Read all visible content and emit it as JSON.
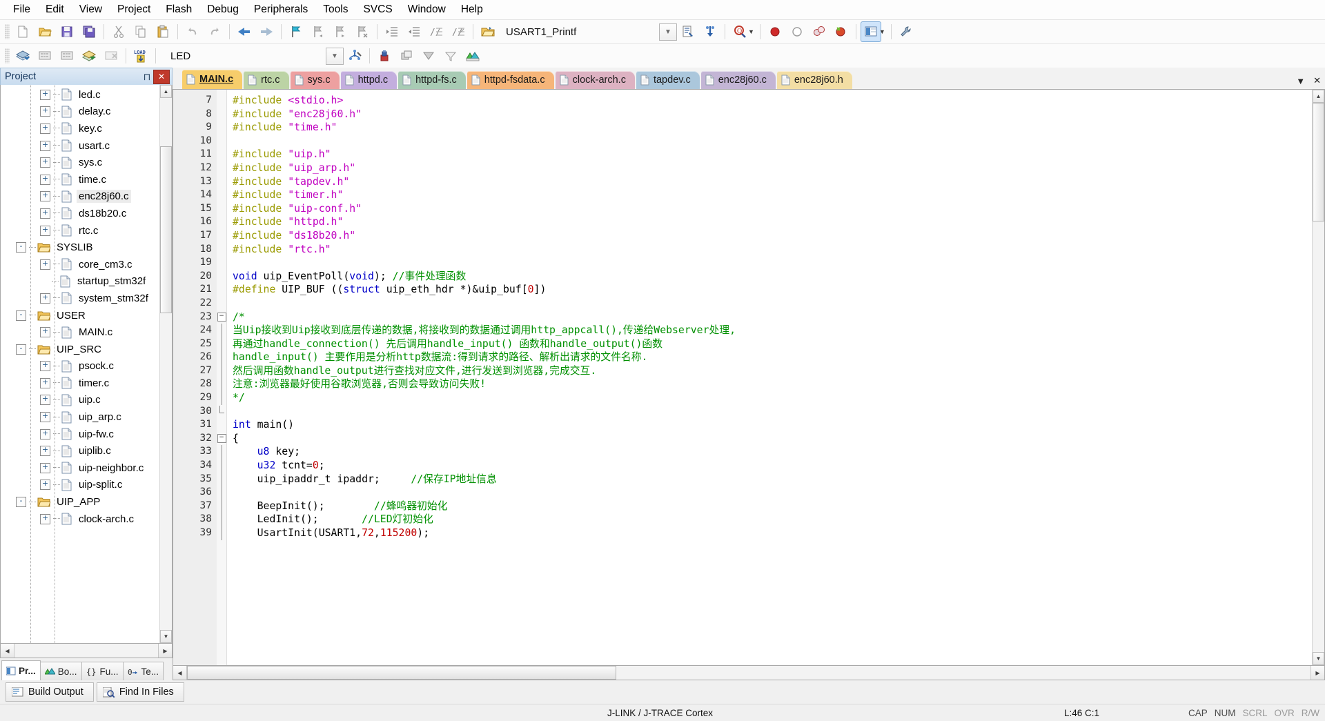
{
  "menu": {
    "items": [
      "File",
      "Edit",
      "View",
      "Project",
      "Flash",
      "Debug",
      "Peripherals",
      "Tools",
      "SVCS",
      "Window",
      "Help"
    ]
  },
  "toolbar1": {
    "icons": [
      {
        "name": "new-file-icon",
        "glyph": "new"
      },
      {
        "name": "open-file-icon",
        "glyph": "open"
      },
      {
        "name": "save-icon",
        "glyph": "save"
      },
      {
        "name": "save-all-icon",
        "glyph": "saveall"
      },
      {
        "name": "cut-icon",
        "glyph": "cut"
      },
      {
        "name": "copy-icon",
        "glyph": "copy"
      },
      {
        "name": "paste-icon",
        "glyph": "paste"
      },
      {
        "name": "undo-icon",
        "glyph": "undo"
      },
      {
        "name": "redo-icon",
        "glyph": "redo"
      },
      {
        "name": "navigate-back-icon",
        "glyph": "back"
      },
      {
        "name": "navigate-forward-icon",
        "glyph": "forward"
      },
      {
        "name": "bookmark-toggle-icon",
        "glyph": "bm-toggle"
      },
      {
        "name": "bookmark-prev-icon",
        "glyph": "bm-prev"
      },
      {
        "name": "bookmark-next-icon",
        "glyph": "bm-next"
      },
      {
        "name": "bookmark-clear-icon",
        "glyph": "bm-clear"
      },
      {
        "name": "indent-icon",
        "glyph": "indent"
      },
      {
        "name": "outdent-icon",
        "glyph": "outdent"
      },
      {
        "name": "comment-icon",
        "glyph": "comment"
      },
      {
        "name": "uncomment-icon",
        "glyph": "uncomment"
      }
    ],
    "project_name": "USART1_Printf",
    "project_icon": "project-folder-icon",
    "after_combo": [
      {
        "name": "target-options-icon",
        "glyph": "target-opt"
      },
      {
        "name": "manage-components-icon",
        "glyph": "manage"
      },
      {
        "name": "find-in-files-icon",
        "glyph": "find-q"
      },
      {
        "name": "insert-breakpoint-icon",
        "glyph": "bp-red"
      },
      {
        "name": "disable-breakpoint-icon",
        "glyph": "bp-hollow"
      },
      {
        "name": "disable-all-breakpoints-icon",
        "glyph": "bp-dis"
      },
      {
        "name": "kill-all-breakpoints-icon",
        "glyph": "bp-kill"
      },
      {
        "name": "configuration-wizard-icon",
        "glyph": "cfgwiz"
      },
      {
        "name": "utilities-icon",
        "glyph": "wrench"
      }
    ]
  },
  "toolbar2": {
    "icons": [
      {
        "name": "translate-icon",
        "glyph": "translate"
      },
      {
        "name": "build-icon",
        "glyph": "build"
      },
      {
        "name": "rebuild-icon",
        "glyph": "rebuild"
      },
      {
        "name": "batch-build-icon",
        "glyph": "batchbuild"
      },
      {
        "name": "stop-build-icon",
        "glyph": "stopbuild"
      },
      {
        "name": "download-icon",
        "glyph": "load"
      }
    ],
    "target_name": "LED",
    "after_combo": [
      {
        "name": "target-options-icon-2",
        "glyph": "tgt-opt2"
      },
      {
        "name": "manage-project-items-icon",
        "glyph": "mpi"
      },
      {
        "name": "multi-project-icon",
        "glyph": "multi"
      },
      {
        "name": "source-browse-icon",
        "glyph": "srcbrowse"
      },
      {
        "name": "filter-icon",
        "glyph": "filter"
      },
      {
        "name": "books-icon",
        "glyph": "books"
      }
    ]
  },
  "project_pane": {
    "title": "Project",
    "pin_icon": "pin-icon",
    "close_icon": "close-icon",
    "tree": [
      {
        "label": "led.c",
        "type": "file",
        "depth": 2,
        "expander": "+"
      },
      {
        "label": "delay.c",
        "type": "file",
        "depth": 2,
        "expander": "+"
      },
      {
        "label": "key.c",
        "type": "file",
        "depth": 2,
        "expander": "+"
      },
      {
        "label": "usart.c",
        "type": "file",
        "depth": 2,
        "expander": "+"
      },
      {
        "label": "sys.c",
        "type": "file",
        "depth": 2,
        "expander": "+"
      },
      {
        "label": "time.c",
        "type": "file",
        "depth": 2,
        "expander": "+"
      },
      {
        "label": "enc28j60.c",
        "type": "file",
        "depth": 2,
        "expander": "+",
        "selected": true
      },
      {
        "label": "ds18b20.c",
        "type": "file",
        "depth": 2,
        "expander": "+"
      },
      {
        "label": "rtc.c",
        "type": "file",
        "depth": 2,
        "expander": "+"
      },
      {
        "label": "SYSLIB",
        "type": "folder",
        "depth": 1,
        "expander": "-"
      },
      {
        "label": "core_cm3.c",
        "type": "file",
        "depth": 2,
        "expander": "+"
      },
      {
        "label": "startup_stm32f",
        "type": "file",
        "depth": 2,
        "expander": ""
      },
      {
        "label": "system_stm32f",
        "type": "file",
        "depth": 2,
        "expander": "+"
      },
      {
        "label": "USER",
        "type": "folder",
        "depth": 1,
        "expander": "-"
      },
      {
        "label": "MAIN.c",
        "type": "file",
        "depth": 2,
        "expander": "+"
      },
      {
        "label": "UIP_SRC",
        "type": "folder",
        "depth": 1,
        "expander": "-"
      },
      {
        "label": "psock.c",
        "type": "file",
        "depth": 2,
        "expander": "+"
      },
      {
        "label": "timer.c",
        "type": "file",
        "depth": 2,
        "expander": "+"
      },
      {
        "label": "uip.c",
        "type": "file",
        "depth": 2,
        "expander": "+"
      },
      {
        "label": "uip_arp.c",
        "type": "file",
        "depth": 2,
        "expander": "+"
      },
      {
        "label": "uip-fw.c",
        "type": "file",
        "depth": 2,
        "expander": "+"
      },
      {
        "label": "uiplib.c",
        "type": "file",
        "depth": 2,
        "expander": "+"
      },
      {
        "label": "uip-neighbor.c",
        "type": "file",
        "depth": 2,
        "expander": "+"
      },
      {
        "label": "uip-split.c",
        "type": "file",
        "depth": 2,
        "expander": "+"
      },
      {
        "label": "UIP_APP",
        "type": "folder",
        "depth": 1,
        "expander": "-"
      },
      {
        "label": "clock-arch.c",
        "type": "file",
        "depth": 2,
        "expander": "+"
      }
    ],
    "tabs": [
      {
        "label": "Pr...",
        "icon": "project-tab-icon",
        "active": true
      },
      {
        "label": "Bo...",
        "icon": "books-tab-icon",
        "active": false
      },
      {
        "label": "Fu...",
        "icon": "functions-tab-icon",
        "active": false
      },
      {
        "label": "Te...",
        "icon": "templates-tab-icon",
        "active": false
      }
    ]
  },
  "editor": {
    "tabs": [
      {
        "label": "MAIN.c",
        "color": "#f7cd6b",
        "active": true
      },
      {
        "label": "rtc.c",
        "color": "#bcd3a5",
        "active": false
      },
      {
        "label": "sys.c",
        "color": "#eda0a0",
        "active": false
      },
      {
        "label": "httpd.c",
        "color": "#c3aede",
        "active": false
      },
      {
        "label": "httpd-fs.c",
        "color": "#a8cbb4",
        "active": false
      },
      {
        "label": "httpd-fsdata.c",
        "color": "#f6b579",
        "active": false
      },
      {
        "label": "clock-arch.c",
        "color": "#ddb2c2",
        "active": false
      },
      {
        "label": "tapdev.c",
        "color": "#abc7dc",
        "active": false
      },
      {
        "label": "enc28j60.c",
        "color": "#c3b5d5",
        "active": false
      },
      {
        "label": "enc28j60.h",
        "color": "#f3dea4",
        "active": false
      }
    ],
    "tab_scroll_icon": "chevron-down-icon",
    "tab_close_icon": "close-icon",
    "first_line": 7,
    "lines": [
      {
        "n": 7,
        "fold": "",
        "tokens": [
          {
            "t": "#include ",
            "c": "pp"
          },
          {
            "t": "<stdio.h>",
            "c": "st"
          }
        ]
      },
      {
        "n": 8,
        "fold": "",
        "tokens": [
          {
            "t": "#include ",
            "c": "pp"
          },
          {
            "t": "\"enc28j60.h\"",
            "c": "st"
          }
        ]
      },
      {
        "n": 9,
        "fold": "",
        "tokens": [
          {
            "t": "#include ",
            "c": "pp"
          },
          {
            "t": "\"time.h\"",
            "c": "st"
          }
        ]
      },
      {
        "n": 10,
        "fold": "",
        "tokens": []
      },
      {
        "n": 11,
        "fold": "",
        "tokens": [
          {
            "t": "#include ",
            "c": "pp"
          },
          {
            "t": "\"uip.h\"",
            "c": "st"
          }
        ]
      },
      {
        "n": 12,
        "fold": "",
        "tokens": [
          {
            "t": "#include ",
            "c": "pp"
          },
          {
            "t": "\"uip_arp.h\"",
            "c": "st"
          }
        ]
      },
      {
        "n": 13,
        "fold": "",
        "tokens": [
          {
            "t": "#include ",
            "c": "pp"
          },
          {
            "t": "\"tapdev.h\"",
            "c": "st"
          }
        ]
      },
      {
        "n": 14,
        "fold": "",
        "tokens": [
          {
            "t": "#include ",
            "c": "pp"
          },
          {
            "t": "\"timer.h\"",
            "c": "st"
          }
        ]
      },
      {
        "n": 15,
        "fold": "",
        "tokens": [
          {
            "t": "#include ",
            "c": "pp"
          },
          {
            "t": "\"uip-conf.h\"",
            "c": "st"
          }
        ]
      },
      {
        "n": 16,
        "fold": "",
        "tokens": [
          {
            "t": "#include ",
            "c": "pp"
          },
          {
            "t": "\"httpd.h\"",
            "c": "st"
          }
        ]
      },
      {
        "n": 17,
        "fold": "",
        "tokens": [
          {
            "t": "#include ",
            "c": "pp"
          },
          {
            "t": "\"ds18b20.h\"",
            "c": "st"
          }
        ]
      },
      {
        "n": 18,
        "fold": "",
        "tokens": [
          {
            "t": "#include ",
            "c": "pp"
          },
          {
            "t": "\"rtc.h\"",
            "c": "st"
          }
        ]
      },
      {
        "n": 19,
        "fold": "",
        "tokens": []
      },
      {
        "n": 20,
        "fold": "",
        "tokens": [
          {
            "t": "void",
            "c": "k"
          },
          {
            "t": " uip_EventPoll(",
            "c": "pl"
          },
          {
            "t": "void",
            "c": "k"
          },
          {
            "t": "); ",
            "c": "pl"
          },
          {
            "t": "//事件处理函数",
            "c": "cm"
          }
        ]
      },
      {
        "n": 21,
        "fold": "",
        "tokens": [
          {
            "t": "#define",
            "c": "pp"
          },
          {
            "t": " UIP_BUF ((",
            "c": "pl"
          },
          {
            "t": "struct",
            "c": "k"
          },
          {
            "t": " uip_eth_hdr *)&uip_buf[",
            "c": "pl"
          },
          {
            "t": "0",
            "c": "num"
          },
          {
            "t": "])",
            "c": "pl"
          }
        ]
      },
      {
        "n": 22,
        "fold": "",
        "tokens": []
      },
      {
        "n": 23,
        "fold": "-",
        "tokens": [
          {
            "t": "/*",
            "c": "cm"
          }
        ]
      },
      {
        "n": 24,
        "fold": "|",
        "tokens": [
          {
            "t": "当Uip接收到Uip接收到底层传递的数据,将接收到的数据通过调用http_appcall(),传递给Webserver处理,",
            "c": "cm"
          }
        ]
      },
      {
        "n": 25,
        "fold": "|",
        "tokens": [
          {
            "t": "再通过handle_connection() 先后调用handle_input() 函数和handle_output()函数",
            "c": "cm"
          }
        ]
      },
      {
        "n": 26,
        "fold": "|",
        "tokens": [
          {
            "t": "handle_input() 主要作用是分析http数据流:得到请求的路径、解析出请求的文件名称.",
            "c": "cm"
          }
        ]
      },
      {
        "n": 27,
        "fold": "|",
        "tokens": [
          {
            "t": "然后调用函数handle_output进行查找对应文件,进行发送到浏览器,完成交互.",
            "c": "cm"
          }
        ]
      },
      {
        "n": 28,
        "fold": "|",
        "tokens": [
          {
            "t": "注意:浏览器最好使用谷歌浏览器,否则会导致访问失败!",
            "c": "cm"
          }
        ]
      },
      {
        "n": 29,
        "fold": "|",
        "tokens": [
          {
            "t": "*/",
            "c": "cm"
          }
        ]
      },
      {
        "n": 30,
        "fold": "L",
        "tokens": []
      },
      {
        "n": 31,
        "fold": "",
        "tokens": [
          {
            "t": "int",
            "c": "k"
          },
          {
            "t": " main()",
            "c": "pl"
          }
        ]
      },
      {
        "n": 32,
        "fold": "-",
        "tokens": [
          {
            "t": "{",
            "c": "pl"
          }
        ]
      },
      {
        "n": 33,
        "fold": "|",
        "tokens": [
          {
            "t": "    ",
            "c": "pl"
          },
          {
            "t": "u8",
            "c": "k"
          },
          {
            "t": " key;",
            "c": "pl"
          }
        ]
      },
      {
        "n": 34,
        "fold": "|",
        "tokens": [
          {
            "t": "    ",
            "c": "pl"
          },
          {
            "t": "u32",
            "c": "k"
          },
          {
            "t": " tcnt=",
            "c": "pl"
          },
          {
            "t": "0",
            "c": "num"
          },
          {
            "t": ";",
            "c": "pl"
          }
        ]
      },
      {
        "n": 35,
        "fold": "|",
        "tokens": [
          {
            "t": "    uip_ipaddr_t ipaddr;     ",
            "c": "pl"
          },
          {
            "t": "//保存IP地址信息",
            "c": "cm"
          }
        ]
      },
      {
        "n": 36,
        "fold": "|",
        "tokens": []
      },
      {
        "n": 37,
        "fold": "|",
        "tokens": [
          {
            "t": "    BeepInit();        ",
            "c": "pl"
          },
          {
            "t": "//蜂鸣器初始化",
            "c": "cm"
          }
        ]
      },
      {
        "n": 38,
        "fold": "|",
        "tokens": [
          {
            "t": "    LedInit();       ",
            "c": "pl"
          },
          {
            "t": "//LED灯初始化",
            "c": "cm"
          }
        ]
      },
      {
        "n": 39,
        "fold": "|",
        "tokens": [
          {
            "t": "    UsartInit(USART1,",
            "c": "pl"
          },
          {
            "t": "72",
            "c": "num"
          },
          {
            "t": ",",
            "c": "pl"
          },
          {
            "t": "115200",
            "c": "num"
          },
          {
            "t": ");",
            "c": "pl"
          }
        ]
      }
    ]
  },
  "bottom_tabs": [
    {
      "label": "Build Output",
      "icon": "build-output-icon"
    },
    {
      "label": "Find In Files",
      "icon": "find-in-files-icon"
    }
  ],
  "statusbar": {
    "debugger": "J-LINK / J-TRACE Cortex",
    "cursor": "L:46 C:1",
    "indicators": [
      "CAP",
      "NUM",
      "SCRL",
      "OVR",
      "R/W"
    ]
  },
  "colors": {
    "accent": "#c9dcef",
    "keyword": "#0000c8",
    "string": "#c000c0",
    "comment": "#009000",
    "preprocessor": "#9a9a00",
    "number": "#c00000"
  }
}
